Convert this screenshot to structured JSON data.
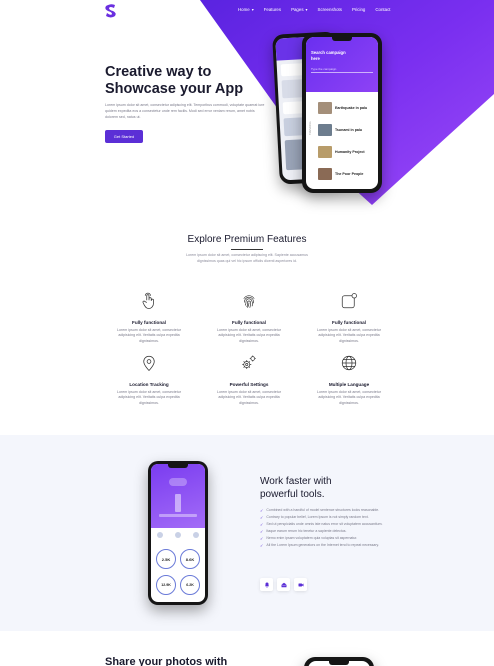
{
  "brand": {
    "logo_letter": "S",
    "accent": "#5b2fd6",
    "accent_light": "#8b3ff5"
  },
  "nav": {
    "items": [
      {
        "label": "Home",
        "has_caret": true
      },
      {
        "label": "Features",
        "has_caret": false
      },
      {
        "label": "Pages",
        "has_caret": true
      },
      {
        "label": "Screenshots",
        "has_caret": false
      },
      {
        "label": "Pricing",
        "has_caret": false
      },
      {
        "label": "Contact",
        "has_caret": false
      }
    ]
  },
  "hero": {
    "title_line1": "Creative way to",
    "title_line2": "Showcase your App",
    "text": "Lorem ipsum dolor sit amet, consectetur adipiscing elit. Temporibus commodi, voluptate quaerat iure quidem expedita eos a consectetur unde rem facilis. Modi sed error veniam rerum, amet nobis dolorem sed, natus ut.",
    "button": "Get Started",
    "phone_screen": {
      "title": "Search campaign here",
      "search_placeholder": "Type the campaign",
      "side_label": "TRENDING",
      "items": [
        {
          "title": "Earthquake in palu"
        },
        {
          "title": "Tsunami in palu"
        },
        {
          "title": "Humanity Project"
        },
        {
          "title": "The Poor People"
        }
      ]
    }
  },
  "features": {
    "title": "Explore Premium Features",
    "text": "Lorem ipsum dolor sit amet, consectetur adipiscing elit. Sapiente accusamus dignissimos quas qui vel hic ipsum officiis dicenti asperiores id.",
    "items": [
      {
        "icon": "touch-icon",
        "title": "Fully functional",
        "text": "Lorem ipsum dolor sit amet, consectetur adipisicing elit. Veritatis culpa expedita dignissimos."
      },
      {
        "icon": "fingerprint-icon",
        "title": "Fully functional",
        "text": "Lorem ipsum dolor sit amet, consectetur adipisicing elit. Veritatis culpa expedita dignissimos."
      },
      {
        "icon": "notification-icon",
        "title": "Fully functional",
        "text": "Lorem ipsum dolor sit amet, consectetur adipisicing elit. Veritatis culpa expedita dignissimos."
      },
      {
        "icon": "location-icon",
        "title": "Location Tracking",
        "text": "Lorem ipsum dolor sit amet, consectetur adipisicing elit. Veritatis culpa expedita dignissimos."
      },
      {
        "icon": "gears-icon",
        "title": "Powerful Settings",
        "text": "Lorem ipsum dolor sit amet, consectetur adipisicing elit. Veritatis culpa expedita dignissimos."
      },
      {
        "icon": "globe-icon",
        "title": "Multiple Language",
        "text": "Lorem ipsum dolor sit amet, consectetur adipisicing elit. Veritatis culpa expedita dignissimos."
      }
    ]
  },
  "work": {
    "title_line1": "Work faster with",
    "title_line2": "powerful tools.",
    "list": [
      "Combined with a handful of model sentence structures looks reasonable.",
      "Contrary to popular belief, Lorem Ipsum is not simply random text.",
      "Sed ut perspiciatis unde omnis iste natus error sit voluptatem accusantium.",
      "Itaque earum rerum hic tenetur a sapiente delectus.",
      "Nemo enim ipsam voluptatem quia voluptas sit aspernatur.",
      "All the Lorem Ipsum generators on the Internet tend to repeat necessary."
    ],
    "tool_icons": [
      "bell-icon",
      "mail-icon",
      "video-icon"
    ],
    "phone": {
      "stat1": "2.5K",
      "stat2": "8.6K",
      "stat3": "12.9K",
      "stat4": "6.2K"
    }
  },
  "share": {
    "title": "Share your photos with"
  }
}
